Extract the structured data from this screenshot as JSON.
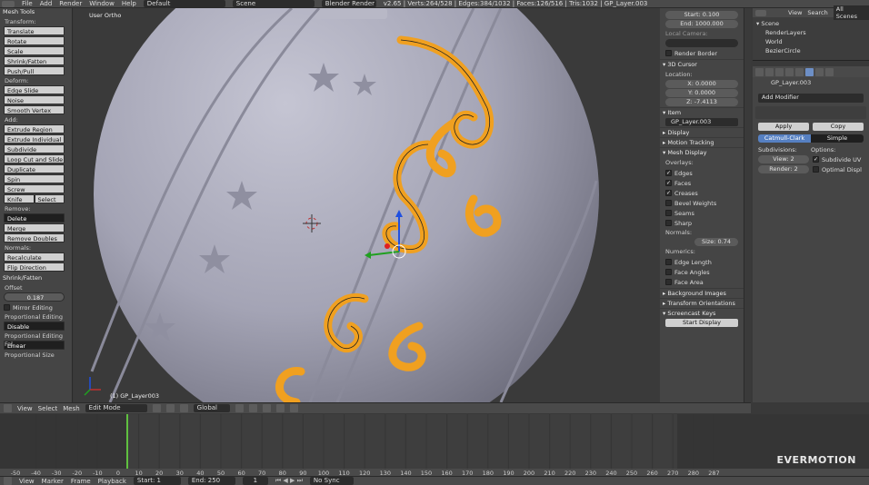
{
  "topbar": {
    "menu": [
      "File",
      "Add",
      "Render",
      "Window",
      "Help"
    ],
    "layout": "Default",
    "scene": "Scene",
    "engine": "Blender Render",
    "stats": "v2.65 | Verts:264/528 | Edges:384/1032 | Faces:126/516 | Tris:1032 | GP_Layer.003"
  },
  "tool_shelf": {
    "title": "Mesh Tools",
    "transform_label": "Transform:",
    "transform": [
      "Translate",
      "Rotate",
      "Scale",
      "Shrink/Fatten",
      "Push/Pull"
    ],
    "deform_label": "Deform:",
    "deform": [
      "Edge Slide",
      "Noise",
      "Smooth Vertex"
    ],
    "add_label": "Add:",
    "add": [
      "Extrude Region",
      "Extrude Individual",
      "Subdivide",
      "Loop Cut and Slide",
      "Duplicate",
      "Spin",
      "Screw"
    ],
    "knife": "Knife",
    "select": "Select",
    "remove_label": "Remove:",
    "delete": "Delete",
    "merge": "Merge",
    "remove_doubles": "Remove Doubles",
    "normals_label": "Normals:",
    "recalculate": "Recalculate",
    "flip_direction": "Flip Direction",
    "op_title": "Shrink/Fatten",
    "offset_label": "Offset",
    "offset_value": "0.187",
    "mirror_editing": "Mirror Editing",
    "prop_editing_label": "Proportional Editing",
    "prop_editing_value": "Disable",
    "prop_falloff_label": "Proportional Editing Fal",
    "prop_falloff_value": "Linear",
    "prop_size_label": "Proportional Size"
  },
  "viewport": {
    "view_label": "User Ortho",
    "object_label": "(1) GP_Layer003"
  },
  "npanel": {
    "start": "Start: 0.100",
    "end": "End: 1000.000",
    "local_camera": "Local Camera:",
    "render_border": "Render Border",
    "cursor_title": "3D Cursor",
    "location_label": "Location:",
    "x": "X: 0.0000",
    "y": "Y: 0.0000",
    "z": "Z: -7.4113",
    "item_title": "Item",
    "item_name": "GP_Layer.003",
    "display": "Display",
    "motion_tracking": "Motion Tracking",
    "mesh_display": "Mesh Display",
    "overlays_label": "Overlays:",
    "overlays": [
      {
        "label": "Edges",
        "checked": true
      },
      {
        "label": "Faces",
        "checked": true
      },
      {
        "label": "Creases",
        "checked": true
      },
      {
        "label": "Bevel Weights",
        "checked": false
      },
      {
        "label": "Seams",
        "checked": false
      },
      {
        "label": "Sharp",
        "checked": false
      }
    ],
    "normals_label": "Normals:",
    "normal_size": "Size: 0.74",
    "numerics_label": "Numerics:",
    "numerics": [
      "Edge Length",
      "Face Angles",
      "Face Area"
    ],
    "background_images": "Background Images",
    "transform_orientations": "Transform Orientations",
    "screencast_keys": "Screencast Keys",
    "start_display": "Start Display"
  },
  "outliner": {
    "view": "View",
    "search": "Search",
    "scope": "All Scenes",
    "items": [
      "Scene",
      "RenderLayers",
      "World",
      "BezierCircle"
    ]
  },
  "properties": {
    "object": "GP_Layer.003",
    "add_modifier": "Add Modifier",
    "apply": "Apply",
    "copy": "Copy",
    "catmull": "Catmull-Clark",
    "simple": "Simple",
    "subdivisions_label": "Subdivisions:",
    "options_label": "Options:",
    "view": "View: 2",
    "render": "Render: 2",
    "subdivide_uv": "Subdivide UV",
    "optimal_display": "Optimal Displ"
  },
  "view_header": {
    "menus": [
      "View",
      "Select",
      "Mesh"
    ],
    "mode": "Edit Mode",
    "orientation": "Global"
  },
  "timeline": {
    "ticks": [
      "-50",
      "-40",
      "-30",
      "-20",
      "-10",
      "0",
      "10",
      "20",
      "30",
      "40",
      "50",
      "60",
      "70",
      "80",
      "90",
      "100",
      "110",
      "120",
      "130",
      "140",
      "150",
      "160",
      "170",
      "180",
      "190",
      "200",
      "210",
      "220",
      "230",
      "240",
      "250",
      "260",
      "270",
      "280",
      "287"
    ],
    "start": "Start: 1",
    "end": "End: 250",
    "current": "1",
    "sync": "No Sync",
    "menus": [
      "View",
      "Marker",
      "Frame",
      "Playback"
    ]
  },
  "watermark": "EVERMOTION",
  "colors": {
    "accent": "#f0a020",
    "selected": "#5680c2",
    "header": "#4a4a4a"
  }
}
